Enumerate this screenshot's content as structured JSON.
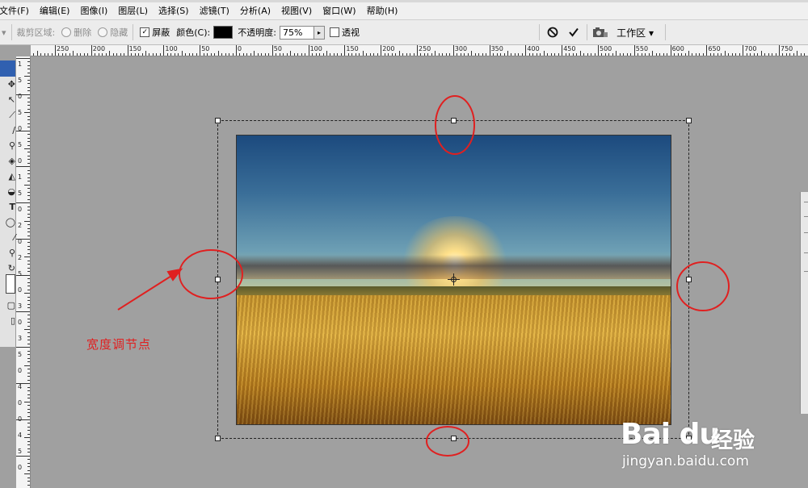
{
  "menu": {
    "items": [
      "文件(F)",
      "编辑(E)",
      "图像(I)",
      "图层(L)",
      "选择(S)",
      "滤镜(T)",
      "分析(A)",
      "视图(V)",
      "窗口(W)",
      "帮助(H)"
    ]
  },
  "options_bar": {
    "crop_area_label": "裁剪区域:",
    "delete_label": "删除",
    "hide_label": "隐藏",
    "shield_label": "屏蔽",
    "color_label": "颜色(C):",
    "color_value": "#000000",
    "opacity_label": "不透明度:",
    "opacity_value": "75%",
    "perspective_label": "透视",
    "workspace_label": "工作区 ▾",
    "cancel_icon": "cancel-icon",
    "commit_icon": "commit-icon",
    "camera_icon": "camera-icon"
  },
  "ruler": {
    "top_labels": [
      "250",
      "200",
      "150",
      "100",
      "50",
      "0",
      "50",
      "100",
      "150",
      "200",
      "250",
      "300",
      "350",
      "400",
      "450",
      "500",
      "550",
      "600",
      "650",
      "700",
      "750"
    ],
    "left_labels": [
      "1",
      "5",
      "0",
      "5",
      "0",
      "5",
      "0",
      "1",
      "5",
      "0",
      "2",
      "0",
      "2",
      "5",
      "0",
      "3",
      "0",
      "3",
      "5",
      "0",
      "4",
      "0",
      "0",
      "4",
      "5",
      "0"
    ]
  },
  "annotation": {
    "label": "宽度调节点",
    "color": "#e02020"
  },
  "watermark": {
    "logo": "Bai du",
    "cn": "经验",
    "url": "jingyan.baidu.com"
  }
}
